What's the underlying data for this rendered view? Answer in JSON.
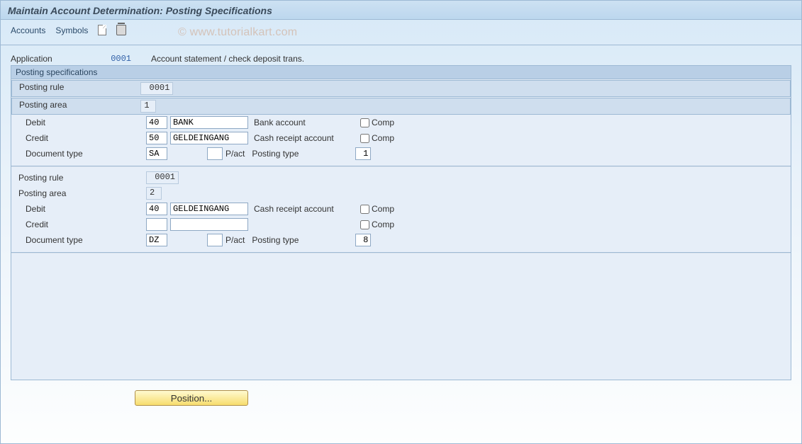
{
  "header": {
    "page_title": "Maintain Account Determination: Posting Specifications"
  },
  "toolbar": {
    "accounts_label": "Accounts",
    "symbols_label": "Symbols",
    "new_icon": "new-document-icon",
    "delete_icon": "trash-icon"
  },
  "watermark": "© www.tutorialkart.com",
  "application": {
    "label": "Application",
    "value": "0001",
    "description": "Account statement / check deposit trans."
  },
  "panel_title": "Posting specifications",
  "labels": {
    "posting_rule": "Posting rule",
    "posting_area": "Posting area",
    "debit": "Debit",
    "credit": "Credit",
    "document_type": "Document type",
    "pact": "P/act",
    "posting_type": "Posting type",
    "comp": "Comp"
  },
  "blocks": [
    {
      "posting_rule": "0001",
      "posting_area": "1",
      "debit": {
        "key": "40",
        "symbol": "BANK",
        "text": "Bank account",
        "comp": false
      },
      "credit": {
        "key": "50",
        "symbol": "GELDEINGANG",
        "text": "Cash receipt account",
        "comp": false
      },
      "doc_type": "SA",
      "pact": "",
      "posting_type": "1"
    },
    {
      "posting_rule": "0001",
      "posting_area": "2",
      "debit": {
        "key": "40",
        "symbol": "GELDEINGANG",
        "text": "Cash receipt account",
        "comp": false
      },
      "credit": {
        "key": "",
        "symbol": "",
        "text": "",
        "comp": false
      },
      "doc_type": "DZ",
      "pact": "",
      "posting_type": "8"
    }
  ],
  "buttons": {
    "position": "Position..."
  }
}
